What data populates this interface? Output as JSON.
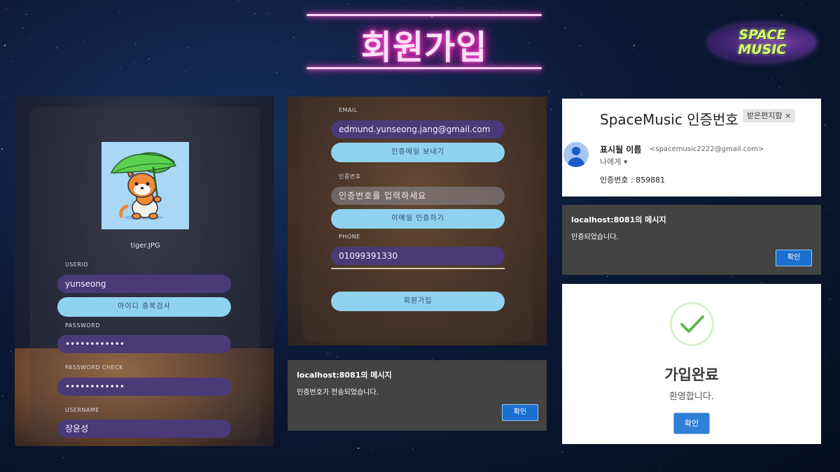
{
  "header": {
    "title": "회원가입"
  },
  "logo": {
    "line1": "SPACE",
    "line2": "MUSIC"
  },
  "signup_left": {
    "avatar_caption": "tiger.JPG",
    "userid_label": "USERID",
    "userid_value": "yunseong",
    "dup_check_button": "아이디 중복검사",
    "password_label": "PASSWORD",
    "password_value": "••••••••••••",
    "password_check_label": "PASSWORD CHECK",
    "password_check_value": "••••••••••••",
    "username_label": "USERNAME",
    "username_value": "장윤성"
  },
  "signup_mid": {
    "email_label": "EMAIL",
    "email_value": "edmund.yunseong.jang@gmail.com",
    "send_mail_button": "인증메일 보내기",
    "code_label": "인증번호",
    "code_placeholder": "인증번호를 입력하세요",
    "verify_button": "이메일 인증하기",
    "phone_label": "PHONE",
    "phone_value": "01099391330",
    "signup_button": "회원가입"
  },
  "email_card": {
    "subject": "SpaceMusic 인증번호",
    "tag": "받은편지함 ×",
    "from_name": "표시될 이름",
    "from_addr": "<spacemusic2222@gmail.com>",
    "to": "나에게 ▾",
    "body": "인증번호 : 859881"
  },
  "alert_verified": {
    "title": "localhost:8081의 메시지",
    "message": "인증되었습니다.",
    "button": "확인"
  },
  "alert_sent": {
    "title": "localhost:8081의 메시지",
    "message": "인증번호가 전송되었습니다.",
    "button": "확인"
  },
  "success_card": {
    "title": "가입완료",
    "message": "환영합니다.",
    "button": "확인"
  },
  "colors": {
    "neon_pink": "#ff3bc8",
    "input_purple": "#4a3a78",
    "button_sky": "#8fd2ee",
    "alert_gray": "#434343",
    "confirm_blue": "#1a6fd1",
    "check_green": "#62b84b"
  }
}
